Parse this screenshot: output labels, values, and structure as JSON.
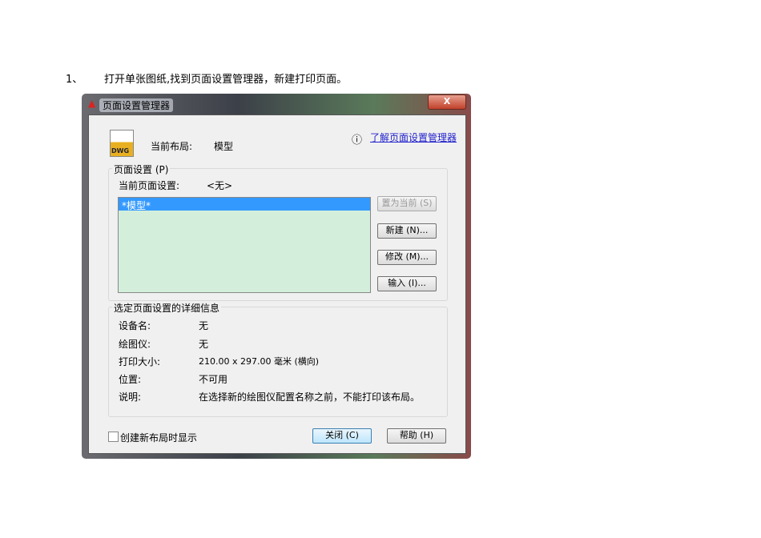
{
  "doc": {
    "step": "1、",
    "text": "打开单张图纸,找到页面设置管理器，新建打印页面。"
  },
  "dialog": {
    "title": "页面设置管理器",
    "close": "X",
    "file_icon": "DWG",
    "current_layout_label": "当前布局:",
    "current_layout_value": "模型",
    "help_link": "了解页面设置管理器",
    "page_setup": {
      "legend": "页面设置 (P)",
      "current_label": "当前页面设置:",
      "current_value": "<无>",
      "items": [
        "*模型*"
      ],
      "buttons": {
        "set_current": "置为当前 (S)",
        "new": "新建 (N)...",
        "modify": "修改 (M)...",
        "import": "输入 (I)..."
      }
    },
    "details": {
      "legend": "选定页面设置的详细信息",
      "rows": [
        {
          "label": "设备名:",
          "value": "无"
        },
        {
          "label": "绘图仪:",
          "value": "无"
        },
        {
          "label": "打印大小:",
          "value": "210.00 x 297.00 毫米 (横向)"
        },
        {
          "label": "位置:",
          "value": "不可用"
        },
        {
          "label": "说明:",
          "value": "在选择新的绘图仪配置名称之前，不能打印该布局。"
        }
      ]
    },
    "show_on_new_layout": "创建新布局时显示",
    "close_button": "关闭 (C)",
    "help_button": "帮助 (H)"
  }
}
